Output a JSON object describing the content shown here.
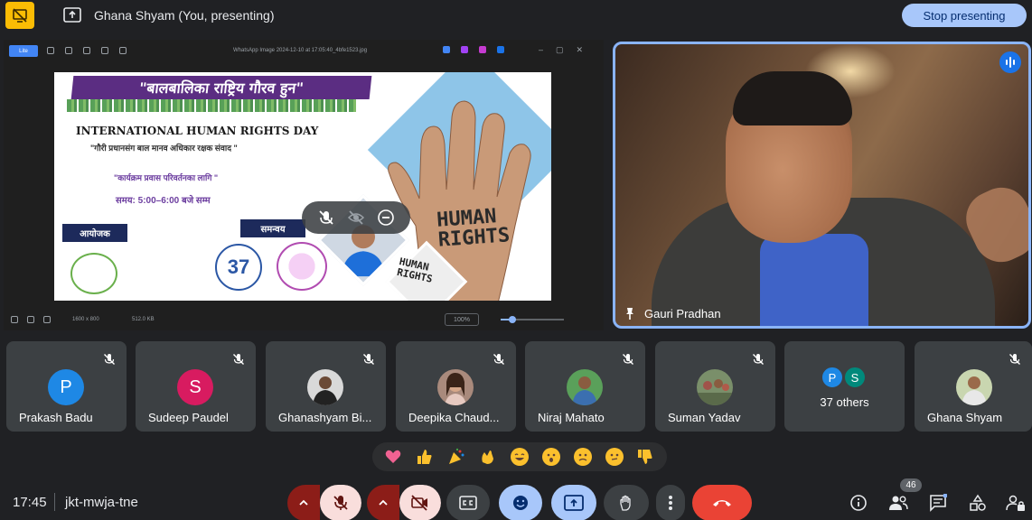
{
  "topbar": {
    "presenting_title": "Ghana Shyam (You, presenting)",
    "stop_label": "Stop presenting"
  },
  "viewer": {
    "tag": "Lite",
    "file_name": "WhatsApp Image 2024-12-10 at 17:05:40_4bfe1523.jpg",
    "dimensions": "1600 x 800",
    "file_size": "512.0 KB",
    "zoom": "100%",
    "zoom_fraction": 0.18
  },
  "poster": {
    "banner": "\"बालबालिका राष्ट्रिय गौरव हुन\"",
    "title": "INTERNATIONAL HUMAN RIGHTS DAY",
    "subtitle": "\"गौरी प्रधानसंग बाल मानव अधिकार रक्षक संवाद \"",
    "line1": "\"कार्यक्रम प्रवास परिवर्तनका लागि \"",
    "time": "समय: 5:00–6:00 बजे सम्म",
    "organizer": "आयोजक",
    "coordinator": "समन्वय",
    "logo_number": "37",
    "human_rights_big": "HUMAN RIGHTS",
    "human_rights_small": "HUMAN RIGHTS"
  },
  "speaker": {
    "name": "Gauri Pradhan"
  },
  "participants": [
    {
      "name": "Prakash Badu",
      "initial": "P",
      "color": "#1e88e5",
      "type": "initial"
    },
    {
      "name": "Sudeep Paudel",
      "initial": "S",
      "color": "#d81b60",
      "type": "initial"
    },
    {
      "name": "Ghanashyam Bi...",
      "type": "photo",
      "color": "#cfcfcf"
    },
    {
      "name": "Deepika Chaud...",
      "type": "photo",
      "color": "#8a6a5a"
    },
    {
      "name": "Niraj Mahato",
      "type": "photo",
      "color": "#4caf50"
    },
    {
      "name": "Suman Yadav",
      "type": "photo",
      "color": "#6d8a5a"
    },
    {
      "name": "Ghana Shyam",
      "type": "photo",
      "color": "#c9d6b0"
    }
  ],
  "others": {
    "label": "37 others",
    "initials": [
      "P",
      "S"
    ],
    "colors": [
      "#1e88e5",
      "#00897b"
    ]
  },
  "reactions": [
    "sparkling-heart",
    "thumbs-up",
    "party-popper",
    "clapping-hands",
    "tears-of-joy",
    "surprised",
    "sad",
    "thinking",
    "thumbs-down"
  ],
  "bottom": {
    "time": "17:45",
    "meeting_code": "jkt-mwja-tne",
    "people_count": "46"
  },
  "colors": {
    "accent": "#8ab4f8",
    "danger": "#ea4335",
    "stop_bg": "#a8c7fa"
  }
}
